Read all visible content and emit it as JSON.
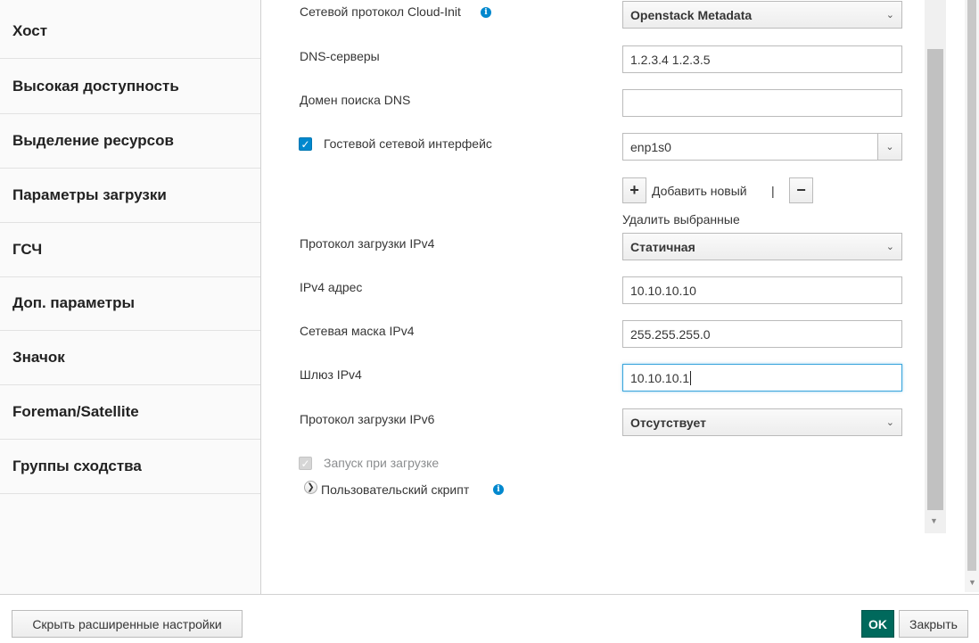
{
  "sidebar": {
    "items": [
      {
        "label": "Хост"
      },
      {
        "label": "Высокая доступность"
      },
      {
        "label": "Выделение ресурсов"
      },
      {
        "label": "Параметры загрузки"
      },
      {
        "label": "ГСЧ"
      },
      {
        "label": "Доп. параметры"
      },
      {
        "label": "Значок"
      },
      {
        "label": "Foreman/Satellite"
      },
      {
        "label": "Группы сходства"
      }
    ]
  },
  "form": {
    "cloud_init_protocol": {
      "label": "Сетевой протокол Cloud-Init",
      "value": "Openstack Metadata"
    },
    "dns_servers": {
      "label": "DNS-серверы",
      "value": "1.2.3.4 1.2.3.5"
    },
    "dns_search_domain": {
      "label": "Домен поиска DNS",
      "value": ""
    },
    "guest_interface": {
      "label": "Гостевой сетевой интерфейс",
      "checked": true,
      "value": "enp1s0"
    },
    "add_new_label": "Добавить новый",
    "separator": "|",
    "remove_selected_label": "Удалить выбранные",
    "ipv4_boot_protocol": {
      "label": "Протокол загрузки IPv4",
      "value": "Статичная"
    },
    "ipv4_address": {
      "label": "IPv4 адрес",
      "value": "10.10.10.10"
    },
    "ipv4_netmask": {
      "label": "Сетевая маска IPv4",
      "value": "255.255.255.0"
    },
    "ipv4_gateway": {
      "label": "Шлюз IPv4",
      "value": "10.10.10.1"
    },
    "ipv6_boot_protocol": {
      "label": "Протокол загрузки IPv6",
      "value": "Отсутствует"
    },
    "start_on_boot": {
      "label": "Запуск при загрузке",
      "checked": true,
      "disabled": true
    },
    "custom_script": {
      "label": "Пользовательский скрипт"
    }
  },
  "footer": {
    "hide_advanced_label": "Скрыть расширенные настройки",
    "ok_label": "OK",
    "close_label": "Закрыть"
  },
  "colors": {
    "primary": "#00695c",
    "info": "#0088ce",
    "focus": "#39a5dc"
  }
}
